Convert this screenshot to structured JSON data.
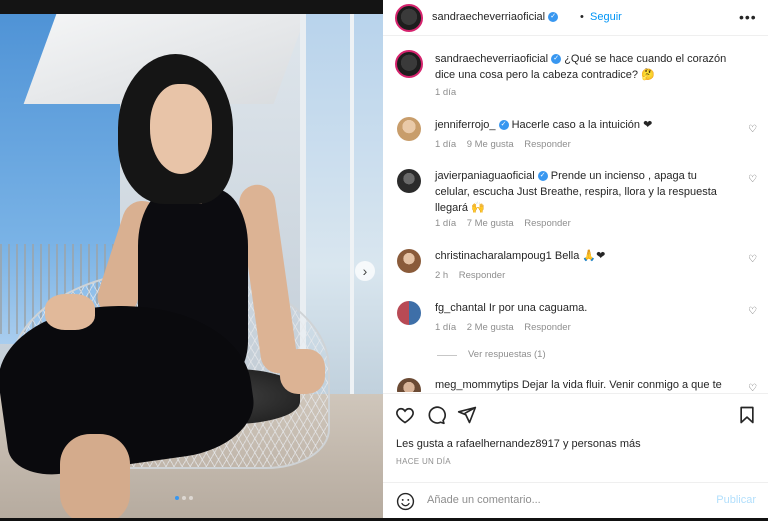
{
  "post": {
    "author": "sandraecheverriaoficial",
    "follow_label": "Seguir",
    "more_label": "•••",
    "caption_user": "sandraecheverriaoficial",
    "caption_text": "¿Qué se hace cuando el corazón dice una cosa pero la cabeza contradice? 🤔",
    "caption_time": "1 día",
    "likes_text": "Les gusta a rafaelhernandez8917 y personas más",
    "posted_ago": "HACE UN DÍA",
    "add_comment_placeholder": "Añade un comentario...",
    "publish_label": "Publicar",
    "carousel_next": "›",
    "carousel_dots": 3,
    "carousel_active_index": 0
  },
  "comments": [
    {
      "user": "jenniferrojo_",
      "verified": true,
      "text": "Hacerle caso a la intuición ❤",
      "time": "1 día",
      "likes": "9 Me gusta",
      "reply": "Responder"
    },
    {
      "user": "javierpaniaguaoficial",
      "verified": true,
      "text_line1": "Prende un incienso , apaga tu",
      "text_line2": "celular, escucha Just Breathe, respira, llora y la respuesta",
      "text_line3": "llegará 🙌",
      "time": "1 día",
      "likes": "7 Me gusta",
      "reply": "Responder"
    },
    {
      "user": "christinacharalampoug1",
      "verified": false,
      "text": "Bella 🙏❤",
      "time": "2 h",
      "reply": "Responder"
    },
    {
      "user": "fg_chantal",
      "verified": false,
      "text": "Ir por una caguama.",
      "time": "1 día",
      "likes": "2 Me gusta",
      "reply": "Responder",
      "view_replies": "Ver respuestas (1)"
    },
    {
      "user": "meg_mommytips",
      "verified": false,
      "text": "Dejar la vida fluir. Venir conmigo a que te"
    }
  ],
  "icons": {
    "like": "heart-outline-icon",
    "comment": "comment-bubble-icon",
    "share": "paper-plane-icon",
    "save": "bookmark-icon",
    "emoji": "smiley-icon",
    "verified": "verified-badge-icon"
  },
  "colors": {
    "link_blue": "#0095f6",
    "verified_blue": "#3897f0",
    "story_ring": "#d6246e",
    "heart_red": "#ed4956"
  }
}
